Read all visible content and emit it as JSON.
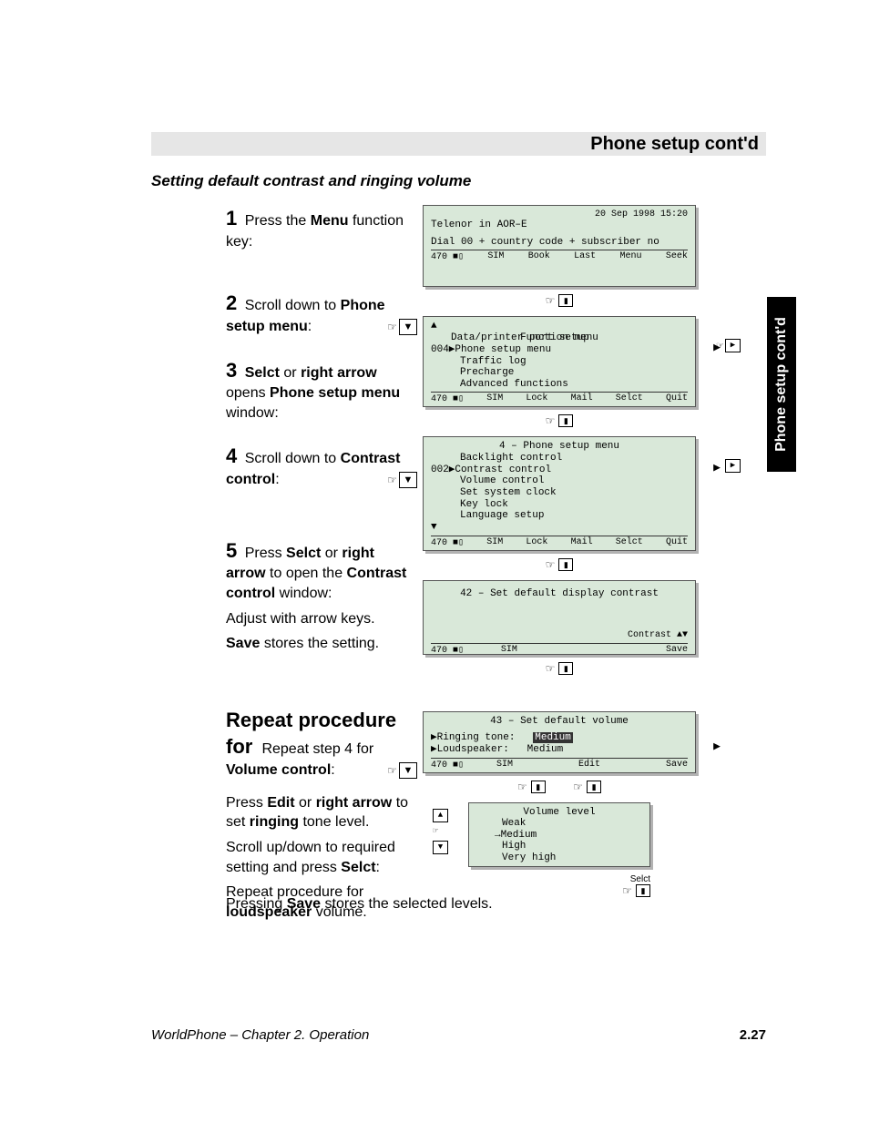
{
  "header": "Phone setup cont'd",
  "sideTab": "Phone setup cont'd",
  "sectionTitle": "Setting default contrast and ringing volume",
  "steps": {
    "s1": {
      "n": "1",
      "a": "Press the ",
      "b": "Menu",
      "c": " function key:"
    },
    "s2": {
      "n": "2",
      "a": "Scroll down to ",
      "b": "Phone setup menu",
      "c": ":"
    },
    "s3": {
      "n": "3",
      "a": "Selct",
      "b": " or ",
      "c": "right arrow",
      "d": " opens ",
      "e": "Phone setup menu",
      "f": " window:"
    },
    "s4": {
      "n": "4",
      "a": "Scroll down to ",
      "b": "Contrast control",
      "c": ":"
    },
    "s5": {
      "n": "5",
      "a": "Press ",
      "b": "Selct",
      "c": " or ",
      "d": "right arrow",
      "e": " to open the ",
      "f": "Contrast control",
      "g": " window:",
      "h": "Adjust with arrow keys.",
      "i": "Save",
      "j": " stores the setting."
    },
    "s6": {
      "n": "Repeat procedure for ",
      "a": "Repeat step 4 for ",
      "b": "Volume control",
      "c": ":",
      "d": "Press ",
      "e": "Edit",
      "f": " or ",
      "g": "right arrow",
      "h": " to set ",
      "i": "ringing",
      "j": " tone level.",
      "k": "Scroll up/down to required setting and press ",
      "l": "Selct",
      "m": ":",
      "o": "loudspeaker",
      "p": " volume."
    }
  },
  "finalNote": {
    "a": "Pressing ",
    "b": "Save",
    "c": " stores the selected levels."
  },
  "screen1": {
    "datetime": "20 Sep 1998   15:20",
    "line1": "Telenor in AOR–E",
    "line2": "Dial 00 + country code + subscriber no",
    "status": {
      "a": "470",
      "b": "SIM",
      "c": "Book",
      "d": "Last",
      "e": "Menu",
      "f": "Seek"
    }
  },
  "screen2": {
    "title": "Function menu",
    "l1": "Data/printer port setup",
    "l2": "004▶Phone setup menu",
    "l3": "Traffic log",
    "l4": "Precharge",
    "l5": "Advanced functions",
    "status": {
      "a": "470",
      "b": "SIM",
      "c": "Lock",
      "d": "Mail",
      "e": "Selct",
      "f": "Quit"
    }
  },
  "screen3": {
    "title": "4 – Phone setup menu",
    "l1": "Backlight control",
    "l2": "002▶Contrast control",
    "l3": "Volume control",
    "l4": "Set system clock",
    "l5": "Key lock",
    "l6": "Language setup",
    "status": {
      "a": "470",
      "b": "SIM",
      "c": "Lock",
      "d": "Mail",
      "e": "Selct",
      "f": "Quit"
    }
  },
  "screen4": {
    "title": "42 – Set default display contrast",
    "ctrl": "Contrast ▲▼",
    "status": {
      "a": "470",
      "b": "SIM",
      "save": "Save"
    }
  },
  "screen5": {
    "title": "43 – Set default volume",
    "l1": "▶Ringing tone:",
    "v1": "Medium",
    "l2": "▶Loudspeaker:",
    "v2": "Medium",
    "status": {
      "a": "470",
      "b": "SIM",
      "edit": "Edit",
      "save": "Save"
    }
  },
  "screen6": {
    "title": "Volume level",
    "l1": "Weak",
    "l2": "→Medium",
    "l3": "High",
    "l4": "Very high",
    "selct": "Selct"
  },
  "icons": {
    "hand": "☞",
    "down": "▼",
    "right": "▶",
    "pause": "▮",
    "up": "▲",
    "batt": "■▯"
  },
  "footer": {
    "chapter": "WorldPhone – Chapter 2. Operation",
    "page": "2.27"
  }
}
